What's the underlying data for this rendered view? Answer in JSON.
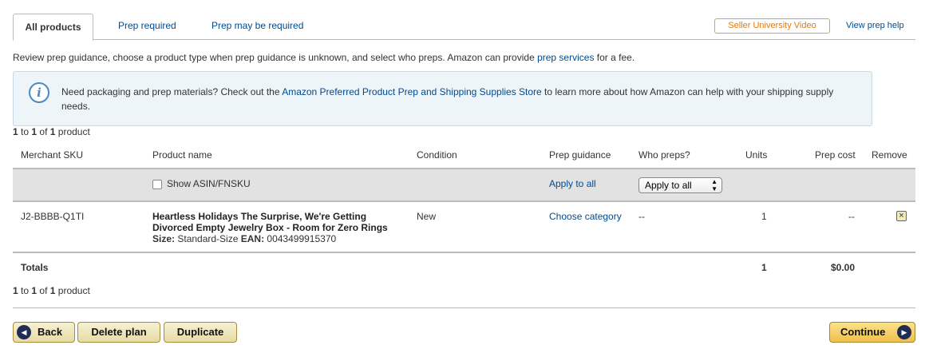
{
  "tabs": {
    "all_products": "All products",
    "prep_required": "Prep required",
    "prep_may_be_required": "Prep may be required",
    "seller_university": "Seller University Video",
    "view_prep_help": "View prep help"
  },
  "intro": {
    "text_before": "Review prep guidance, choose a product type when prep guidance is unknown, and select who preps. Amazon can provide ",
    "link": "prep services",
    "text_after": " for a fee."
  },
  "info": {
    "icon": "info-icon",
    "text_before": "Need packaging and prep materials? Check out the ",
    "link": "Amazon Preferred Product Prep and Shipping Supplies Store",
    "text_after": " to learn more about how Amazon can help with your shipping supply needs."
  },
  "count": {
    "from": "1",
    "to_word": " to ",
    "to": "1",
    "of_word": " of ",
    "total": "1",
    "suffix": " product"
  },
  "table": {
    "headers": {
      "sku": "Merchant SKU",
      "name": "Product name",
      "condition": "Condition",
      "prep_guidance": "Prep guidance",
      "who_preps": "Who preps?",
      "units": "Units",
      "prep_cost": "Prep cost",
      "remove": "Remove"
    },
    "filter": {
      "show_asin": "Show ASIN/FNSKU",
      "apply_to_all_link": "Apply to all",
      "apply_to_all_select": "Apply to all"
    },
    "rows": [
      {
        "sku": "J2-BBBB-Q1TI",
        "name": "Heartless Holidays The Surprise, We're Getting Divorced Empty Jewelry Box - Room for Zero Rings",
        "size_label": "Size:",
        "size_value": " Standard-Size ",
        "ean_label": "EAN:",
        "ean_value": " 0043499915370",
        "condition": "New",
        "prep_guidance": "Choose category",
        "who_preps": "--",
        "units": "1",
        "prep_cost": "--",
        "remove": "×"
      }
    ],
    "totals": {
      "label": "Totals",
      "units": "1",
      "prep_cost": "$0.00"
    }
  },
  "buttons": {
    "back": "Back",
    "delete_plan": "Delete plan",
    "duplicate": "Duplicate",
    "continue": "Continue"
  }
}
